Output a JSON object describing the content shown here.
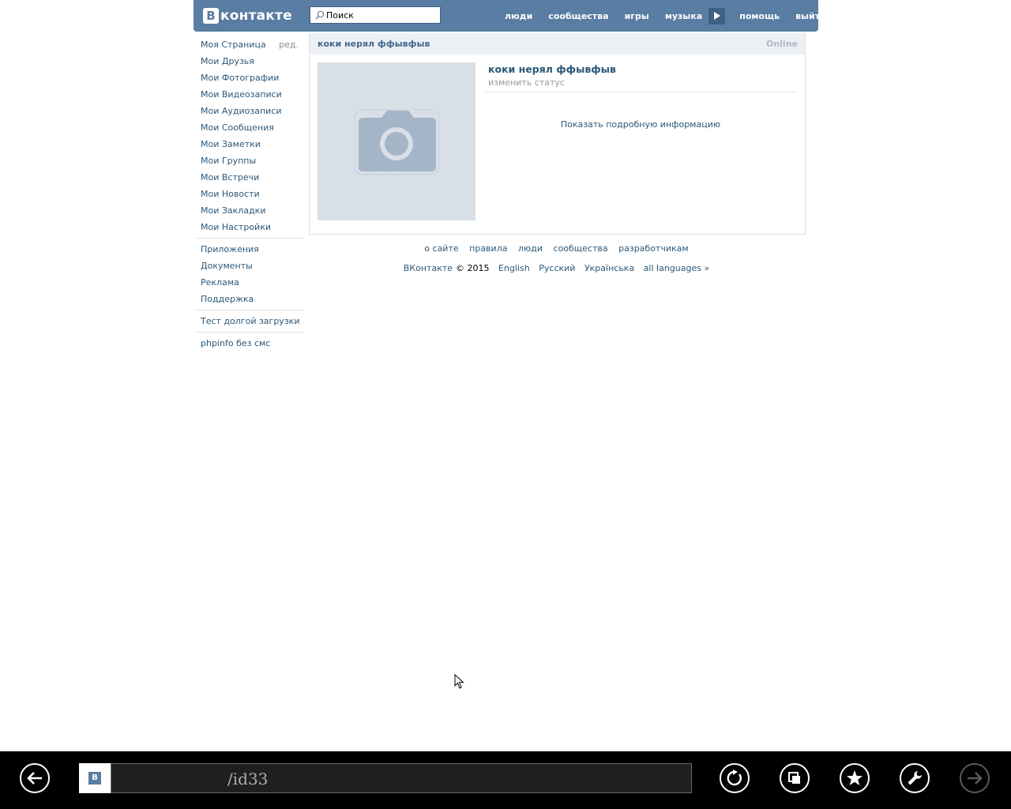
{
  "header": {
    "logo_letter": "В",
    "logo_text": "контакте",
    "search_placeholder": "Поиск",
    "nav": [
      "люди",
      "сообщества",
      "игры",
      "музыка",
      "помощь",
      "выйти"
    ]
  },
  "sidebar": {
    "edit_label": "ред.",
    "group1": [
      "Моя Страница",
      "Мои Друзья",
      "Мои Фотографии",
      "Мои Видеозаписи",
      "Мои Аудиозаписи",
      "Мои Сообщения",
      "Мои Заметки",
      "Мои Группы",
      "Мои Встречи",
      "Мои Новости",
      "Мои Закладки",
      "Мои Настройки"
    ],
    "group2": [
      "Приложения",
      "Документы",
      "Реклама",
      "Поддержка"
    ],
    "group3": [
      "Тест долгой загрузки"
    ],
    "group4": [
      "phpinfo без смс"
    ]
  },
  "profile": {
    "header_name": "коки нерял ффывфыв",
    "online": "Online",
    "full_name": "коки нерял ффывфыв",
    "status": "изменить статус",
    "details_link": "Показать подробную информацию"
  },
  "footer": {
    "links": [
      "о сайте",
      "правила",
      "люди",
      "сообщества",
      "разработчикам"
    ],
    "brand": "ВКонтакте",
    "copyright": "© 2015",
    "languages": [
      "English",
      "Русский",
      "Українська",
      "all languages »"
    ]
  },
  "browser": {
    "favicon_letter": "В",
    "url": "/id33"
  },
  "colors": {
    "header_bg": "#597da3",
    "link": "#2b587a",
    "panel_head": "#edf1f5"
  }
}
